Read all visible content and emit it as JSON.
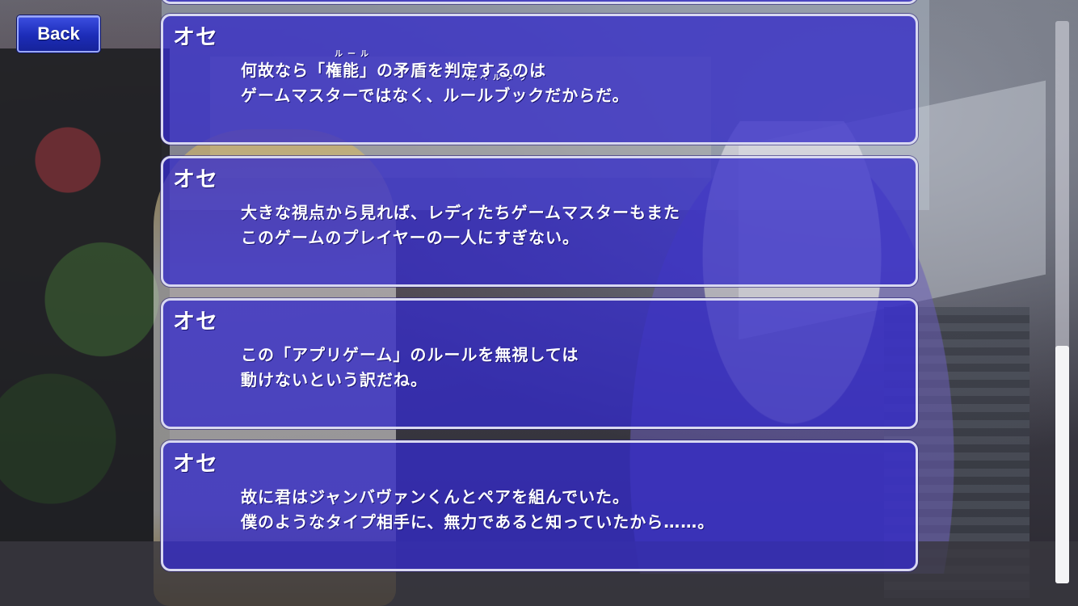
{
  "back_button": {
    "label": "Back"
  },
  "log": {
    "entries": [
      {
        "speaker": "オセ",
        "lines": [
          "何故なら「権能」の矛盾を判定するのは",
          "ゲームマスターではなく、ルールブックだからだ。"
        ],
        "ruby": [
          "ルール",
          "バベルタワー"
        ]
      },
      {
        "speaker": "オセ",
        "lines": [
          "大きな視点から見れば、レディたちゲームマスターもまた",
          "このゲームのプレイヤーの一人にすぎない。"
        ]
      },
      {
        "speaker": "オセ",
        "lines": [
          "この「アプリゲーム」のルールを無視しては",
          "動けないという訳だね。"
        ]
      },
      {
        "speaker": "オセ",
        "lines": [
          "故に君はジャンバヴァンくんとペアを組んでいた。",
          "僕のようなタイプ相手に、無力であると知っていたから……。"
        ]
      }
    ]
  },
  "scroll": {
    "position_fraction": 1.0,
    "visible_fraction": 0.42
  },
  "colors": {
    "panel_fill": "#342cc8",
    "panel_border": "#d8d8f0",
    "back_button_fill": "#1c2cb8",
    "text": "#ffffff"
  }
}
